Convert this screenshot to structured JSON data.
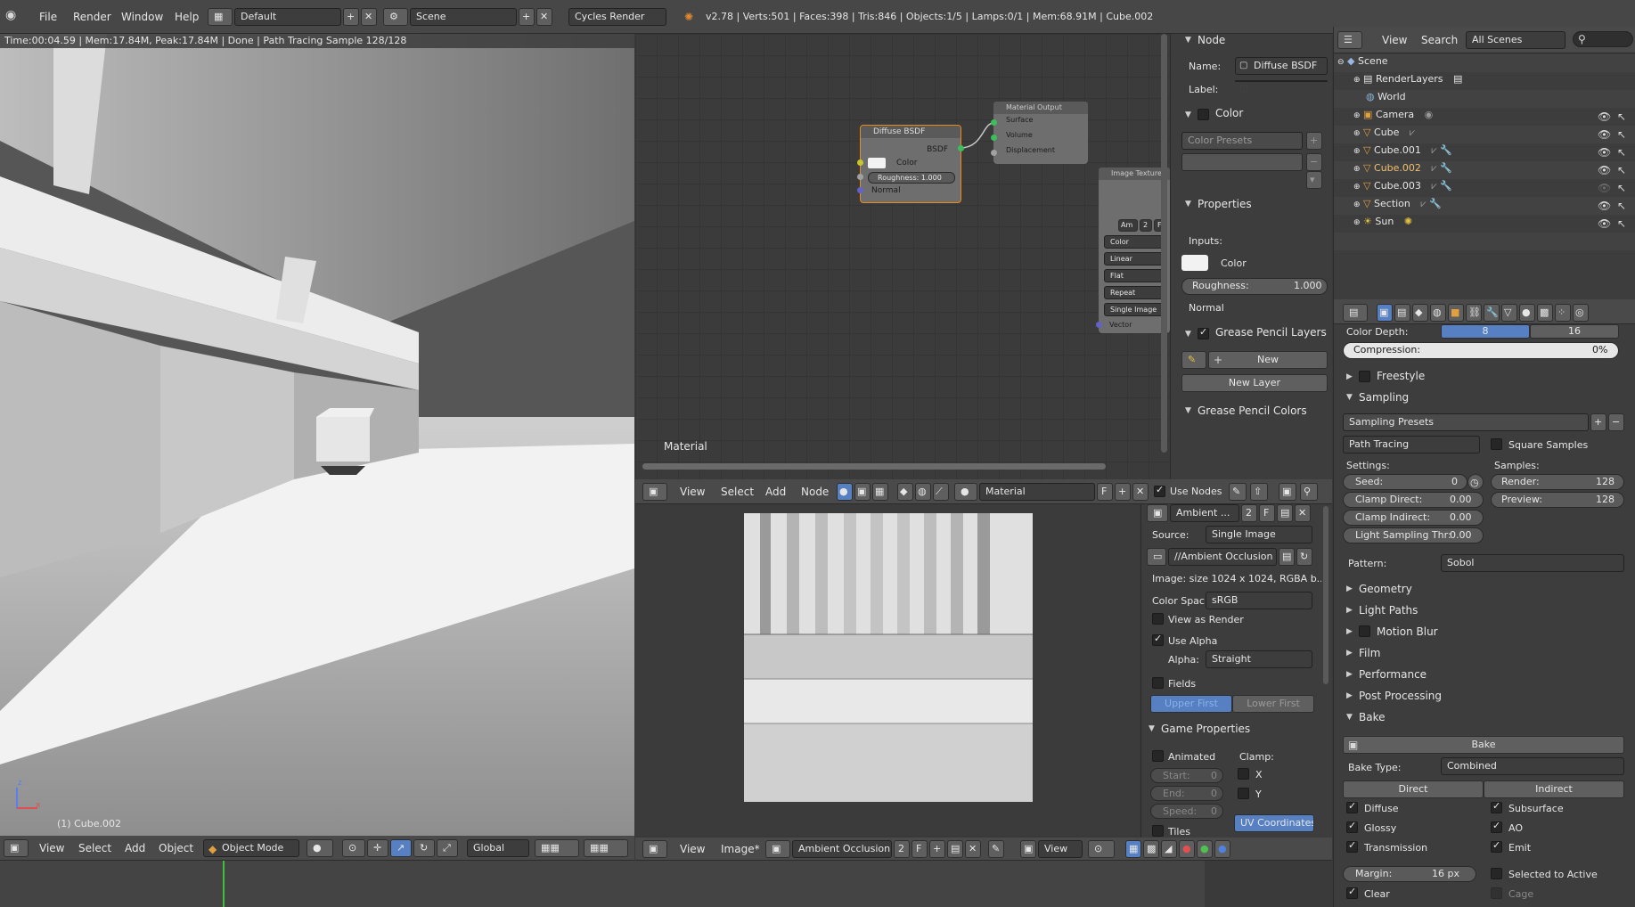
{
  "top_bar": {
    "menus": [
      "File",
      "Render",
      "Window",
      "Help"
    ],
    "layout": "Default",
    "scene": "Scene",
    "engine": "Cycles Render",
    "stats": "v2.78 | Verts:501 | Faces:398 | Tris:846 | Objects:1/5 | Lamps:0/1 | Mem:68.91M | Cube.002"
  },
  "viewport": {
    "render_info": "Time:00:04.59 | Mem:17.84M, Peak:17.84M | Done | Path Tracing Sample 128/128",
    "object_label": "(1) Cube.002",
    "axis_z": "z",
    "axis_x": "x",
    "menus": [
      "View",
      "Select",
      "Add",
      "Object"
    ],
    "mode": "Object Mode",
    "orientation": "Global"
  },
  "node_editor": {
    "nodes": {
      "diffuse_title": "Diffuse BSDF",
      "diffuse_out": "BSDF",
      "diffuse_color": "Color",
      "diffuse_roughness": "Roughness:  1.000",
      "diffuse_normal": "Normal",
      "output_title": "Material Output",
      "output_surface": "Surface",
      "output_volume": "Volume",
      "output_displacement": "Displacement",
      "image_title": "Image Texture",
      "image_buttons": [
        "Am",
        "2",
        "F"
      ],
      "image_options": [
        "Color",
        "Linear",
        "Flat",
        "Repeat",
        "Single Image"
      ],
      "image_vector": "Vector"
    },
    "material_label": "Material",
    "menus": [
      "View",
      "Select",
      "Add",
      "Node"
    ],
    "material_field": "Material",
    "f_label": "F",
    "use_nodes": "Use Nodes"
  },
  "node_props": {
    "node_header": "Node",
    "name_label": "Name:",
    "name_value": "Diffuse BSDF",
    "label_label": "Label:",
    "color_header": "Color",
    "color_presets": "Color Presets",
    "properties_header": "Properties",
    "inputs_label": "Inputs:",
    "color_label": "Color",
    "roughness": "Roughness:",
    "roughness_value": "1.000",
    "normal_label": "Normal",
    "gp_layers": "Grease Pencil Layers",
    "new_button": "New",
    "new_layer_button": "New Layer",
    "gp_colors": "Grease Pencil Colors"
  },
  "image_editor": {
    "menus": [
      "View",
      "Image*"
    ],
    "image_name": "Ambient Occlusion ...",
    "users": "2",
    "f_label": "F",
    "view_mode": "View"
  },
  "image_props": {
    "name": "Ambient ...",
    "users": "2",
    "f": "F",
    "source_label": "Source:",
    "source_value": "Single Image",
    "file": "//Ambient Occlusion ...",
    "info": "Image: size 1024 x 1024, RGBA b...",
    "color_space_label": "Color Spac",
    "color_space_value": "sRGB",
    "view_as_render": "View as Render",
    "use_alpha": "Use Alpha",
    "alpha_label": "Alpha:",
    "alpha_value": "Straight",
    "fields": "Fields",
    "upper_first": "Upper First",
    "lower_first": "Lower First",
    "game_props": "Game Properties",
    "animated": "Animated",
    "clamp_label": "Clamp:",
    "start": "Start:",
    "start_val": "0",
    "end": "End:",
    "end_val": "0",
    "speed": "Speed:",
    "speed_val": "0",
    "clamp_x": "X",
    "clamp_y": "Y",
    "tiles": "Tiles",
    "uv_coords": "UV Coordinates"
  },
  "outliner": {
    "menus": [
      "View",
      "Search"
    ],
    "scope": "All Scenes",
    "items": [
      {
        "name": "Scene",
        "level": 0
      },
      {
        "name": "RenderLayers",
        "level": 1
      },
      {
        "name": "World",
        "level": 1
      },
      {
        "name": "Camera",
        "level": 1
      },
      {
        "name": "Cube",
        "level": 1
      },
      {
        "name": "Cube.001",
        "level": 1
      },
      {
        "name": "Cube.002",
        "level": 1
      },
      {
        "name": "Cube.003",
        "level": 1
      },
      {
        "name": "Section",
        "level": 1
      },
      {
        "name": "Sun",
        "level": 1
      }
    ]
  },
  "render_props": {
    "color_depth_label": "Color Depth:",
    "color_depth_8": "8",
    "color_depth_16": "16",
    "compression_label": "Compression:",
    "compression_value": "0%",
    "freestyle": "Freestyle",
    "sampling": "Sampling",
    "sampling_presets": "Sampling Presets",
    "integrator": "Path Tracing",
    "square_samples": "Square Samples",
    "settings_label": "Settings:",
    "samples_label": "Samples:",
    "seed_label": "Seed:",
    "seed_value": "0",
    "clamp_direct_label": "Clamp Direct:",
    "clamp_direct_value": "0.00",
    "clamp_indirect_label": "Clamp Indirect:",
    "clamp_indirect_value": "0.00",
    "light_threshold_label": "Light Sampling Thr:",
    "light_threshold_value": "0.00",
    "render_label": "Render:",
    "render_value": "128",
    "preview_label": "Preview:",
    "preview_value": "128",
    "pattern_label": "Pattern:",
    "pattern_value": "Sobol",
    "collapsed": [
      "Geometry",
      "Light Paths",
      "Motion Blur",
      "Film",
      "Performance",
      "Post Processing"
    ],
    "bake": "Bake",
    "bake_button": "Bake",
    "bake_type_label": "Bake Type:",
    "bake_type_value": "Combined",
    "direct": "Direct",
    "indirect": "Indirect",
    "diffuse": "Diffuse",
    "subsurface": "Subsurface",
    "glossy": "Glossy",
    "ao": "AO",
    "transmission": "Transmission",
    "emit": "Emit",
    "margin_label": "Margin:",
    "margin_value": "16 px",
    "selected_to_active": "Selected to Active",
    "clear": "Clear",
    "cage": "Cage"
  }
}
